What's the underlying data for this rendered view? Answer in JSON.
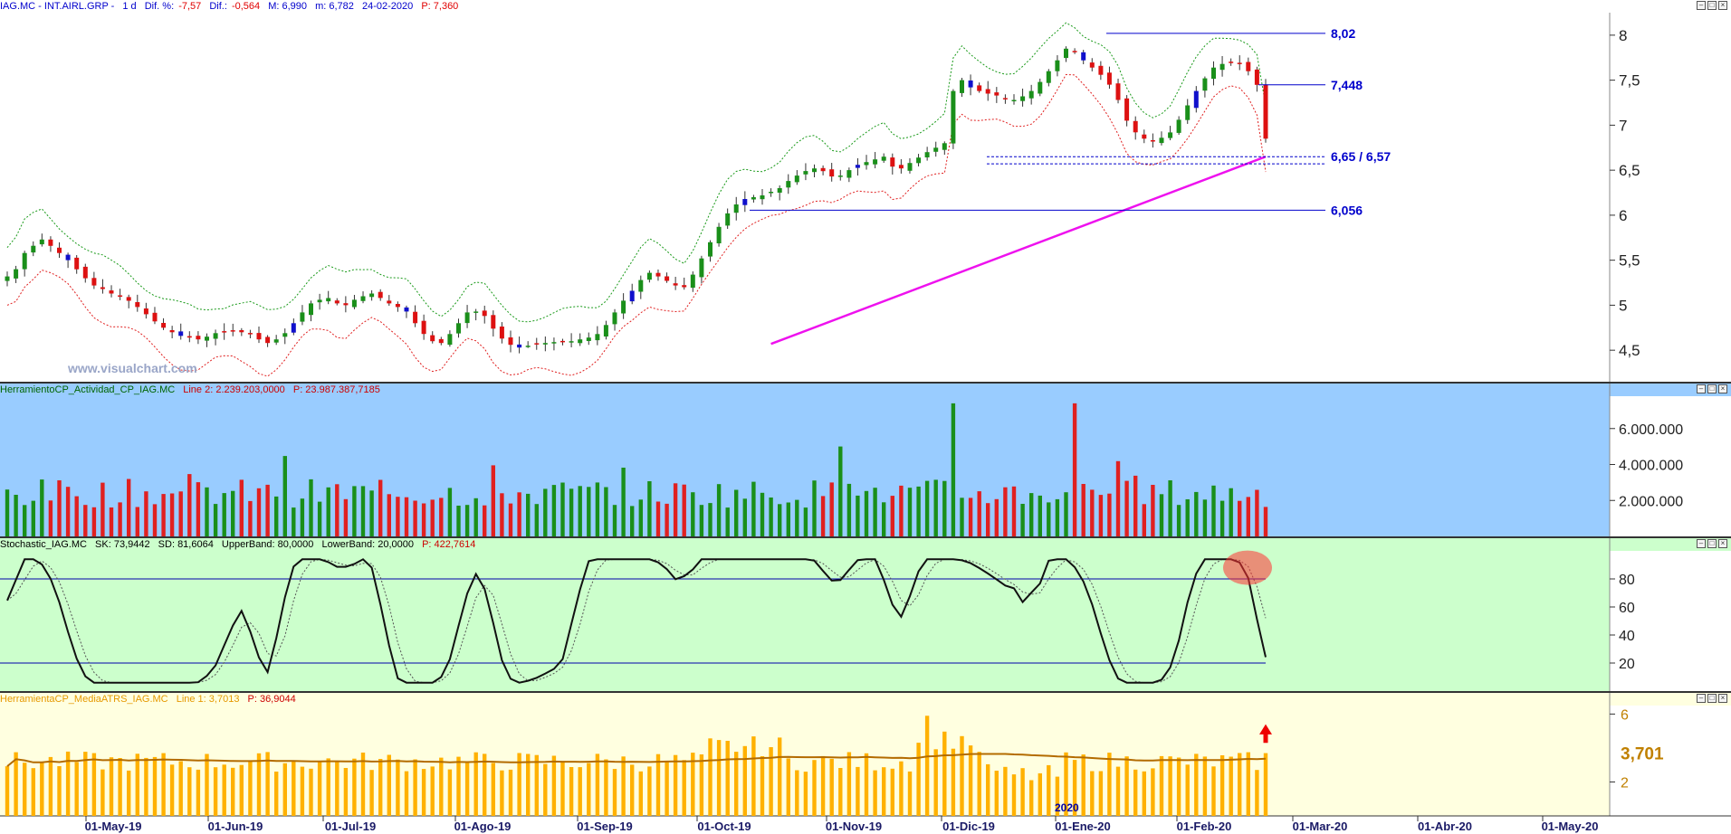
{
  "panels": {
    "price": {
      "header": {
        "symbol": "IAG.MC - INT.AIRL.GRP -",
        "tf": "1 d",
        "dif_pct_label": "Dif. %:",
        "dif_pct_value": "-7,57",
        "dif_label": "Dif.:",
        "dif_value": "-0,564",
        "max": "M: 6,990",
        "min": "m: 6,782",
        "date": "24-02-2020",
        "price": "P: 7,360"
      },
      "watermark": "www.visualchart.com"
    },
    "activity": {
      "header": {
        "name": "HerramientoCP_Actividad_CP_IAG.MC",
        "line": "Line 2: 2.239.203,0000",
        "p": "P: 23.987.387,7185"
      }
    },
    "stochastic": {
      "header": {
        "name": "Stochastic_IAG.MC",
        "sk": "SK: 73,9442",
        "sd": "SD: 81,6064",
        "ub": "UpperBand: 80,0000",
        "lb": "LowerBand: 20,0000",
        "p": "P: 422,7614"
      }
    },
    "atr": {
      "header": {
        "name": "HerramientaCP_MediaATRS_IAG.MC",
        "line": "Line 1: 3,7013",
        "p": "P: 36,9044"
      },
      "year_label": "2020"
    }
  },
  "chart_data": [
    {
      "type": "candlestick",
      "title": "IAG.MC - INT.AIRL.GRP",
      "ylim": [
        4.15,
        8.25
      ],
      "y_ticks": [
        "8",
        "7,5",
        "7",
        "6,5",
        "6",
        "5,5",
        "5",
        "4,5"
      ],
      "x_ticks": [
        "01-May-19",
        "01-Jun-19",
        "01-Jul-19",
        "01-Ago-19",
        "01-Sep-19",
        "01-Oct-19",
        "01-Nov-19",
        "01-Dic-19",
        "01-Ene-20",
        "01-Feb-20",
        "01-Mar-20",
        "01-Abr-20",
        "01-May-20"
      ],
      "closes": [
        5.32,
        5.4,
        5.58,
        5.66,
        5.73,
        5.66,
        5.58,
        5.5,
        5.4,
        5.3,
        5.22,
        5.18,
        5.13,
        5.1,
        5.05,
        4.98,
        4.9,
        4.82,
        4.75,
        4.7,
        4.66,
        4.64,
        4.62,
        4.65,
        4.69,
        4.7,
        4.72,
        4.7,
        4.68,
        4.62,
        4.58,
        4.62,
        4.69,
        4.8,
        4.92,
        5.02,
        5.06,
        5.08,
        5.02,
        5.0,
        5.06,
        5.1,
        5.13,
        5.08,
        5.02,
        4.98,
        4.93,
        4.8,
        4.68,
        4.6,
        4.58,
        4.68,
        4.8,
        4.92,
        4.93,
        4.88,
        4.74,
        4.63,
        4.56,
        4.53,
        4.55,
        4.57,
        4.58,
        4.59,
        4.6,
        4.6,
        4.62,
        4.64,
        4.68,
        4.78,
        4.92,
        5.05,
        5.16,
        5.28,
        5.36,
        5.32,
        5.27,
        5.22,
        5.2,
        5.34,
        5.52,
        5.7,
        5.87,
        6.02,
        6.12,
        6.18,
        6.2,
        6.22,
        6.26,
        6.3,
        6.38,
        6.44,
        6.49,
        6.52,
        6.49,
        6.43,
        6.44,
        6.5,
        6.56,
        6.59,
        6.62,
        6.65,
        6.54,
        6.52,
        6.58,
        6.64,
        6.7,
        6.75,
        6.8,
        7.38,
        7.5,
        7.42,
        7.38,
        7.35,
        7.33,
        7.3,
        7.28,
        7.32,
        7.38,
        7.48,
        7.6,
        7.72,
        7.85,
        7.82,
        7.72,
        7.64,
        7.56,
        7.45,
        7.28,
        7.05,
        6.92,
        6.85,
        6.82,
        6.86,
        6.92,
        7.06,
        7.22,
        7.38,
        7.52,
        7.64,
        7.68,
        7.7,
        7.68,
        7.6,
        7.448,
        6.85
      ],
      "upper_band_levels_note": "dotted green/red envelopes around price",
      "lines": [
        {
          "label": "8,02",
          "value": 8.02
        },
        {
          "label": "7,448",
          "value": 7.448
        },
        {
          "label": "6,65 / 6,57",
          "value": 6.65
        },
        {
          "label": "6,056",
          "value": 6.056
        }
      ]
    },
    {
      "type": "bar",
      "title": "HerramientoCP_Actividad_CP_IAG.MC",
      "ylim": [
        0,
        7800000
      ],
      "y_ticks": [
        "6.000.000",
        "4.000.000",
        "2.000.000"
      ]
    },
    {
      "type": "line",
      "title": "Stochastic_IAG.MC",
      "ylim": [
        0,
        100
      ],
      "y_ticks": [
        "80",
        "60",
        "40",
        "20"
      ],
      "bands": [
        80,
        20
      ]
    },
    {
      "type": "bar",
      "title": "HerramientaCP_MediaATRS_IAG.MC",
      "ylim": [
        0,
        6.5
      ],
      "y_ticks": [
        "6",
        "2"
      ],
      "last_value_label": "3,701"
    }
  ]
}
